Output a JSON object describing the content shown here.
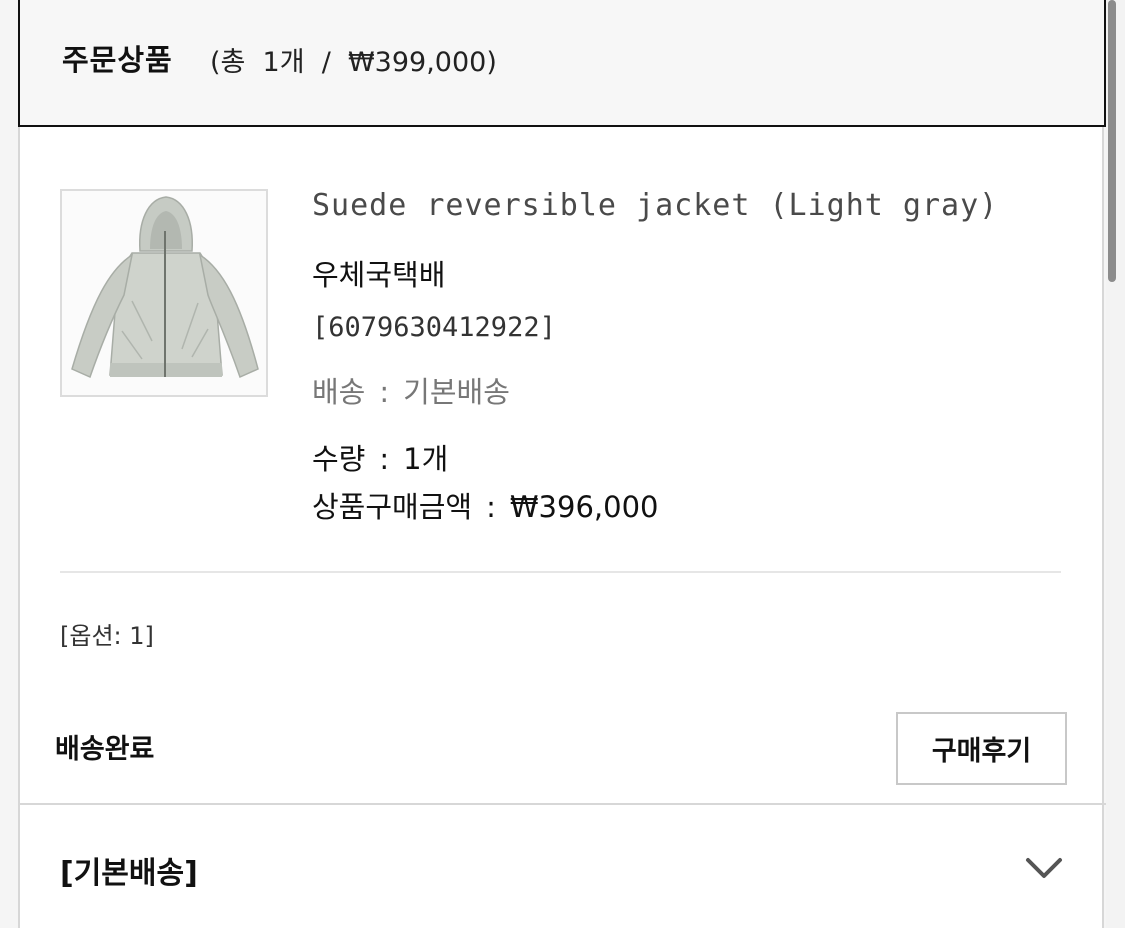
{
  "order_header": {
    "title": "주문상품",
    "summary": "(총  1개  /  ₩399,000)"
  },
  "product": {
    "image_icon": "jacket-photo",
    "name": "Suede reversible jacket (Light gray)",
    "shipping_company": "우체국택배",
    "tracking_number": "[6079630412922]",
    "shipping_type_label": "배송",
    "shipping_type_value": "기본배송",
    "quantity_label": "수량",
    "quantity_value": "1개",
    "price_label": "상품구매금액",
    "price_value": "₩396,000",
    "separator": ":"
  },
  "option_text": "[옵션: 1]",
  "status": "배송완료",
  "review_button": "구매후기",
  "shipping_section": {
    "title": "[기본배송]",
    "toggle_icon": "chevron-down-icon"
  },
  "colors": {
    "header_border": "#111111",
    "panel_border": "#d7d7d7",
    "muted_text": "#777777"
  }
}
